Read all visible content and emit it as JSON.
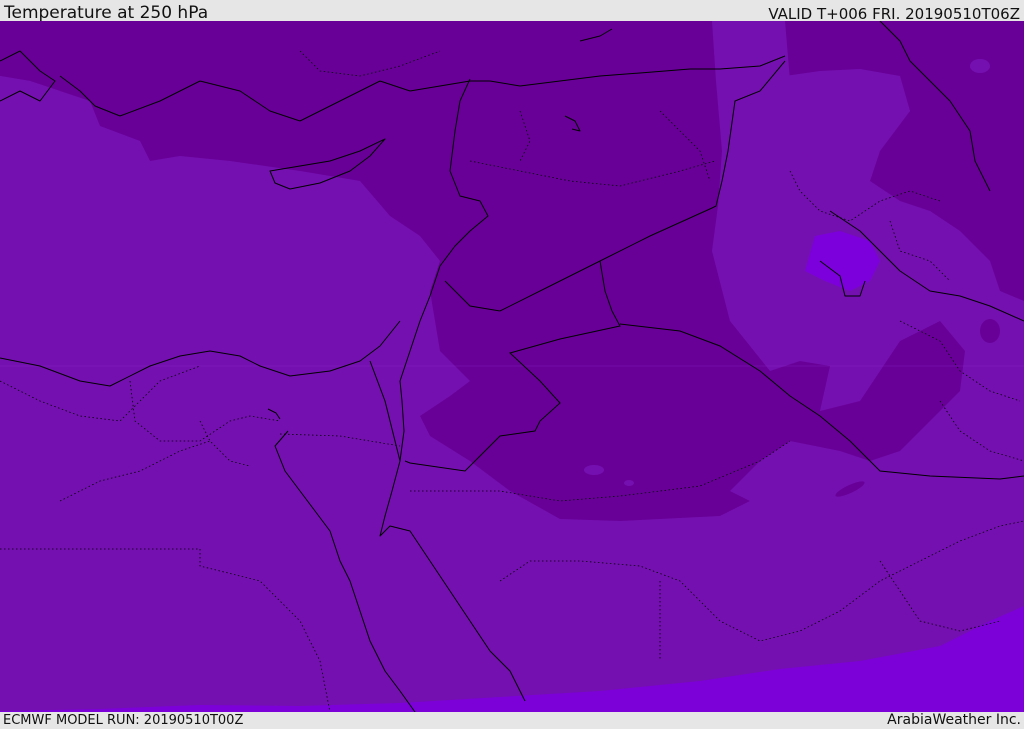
{
  "header": {
    "title": "Temperature at 250 hPa",
    "valid": "VALID T+006 FRI. 20190510T06Z"
  },
  "footer": {
    "model_run": "ECMWF MODEL RUN: 20190510T00Z",
    "credit": "ArabiaWeather Inc."
  },
  "colors": {
    "band_cold": "#670096",
    "band_mid": "#7810b0",
    "band_warm": "#7c00d4",
    "band_warmest": "#7a00dc",
    "lines": "#000000"
  }
}
